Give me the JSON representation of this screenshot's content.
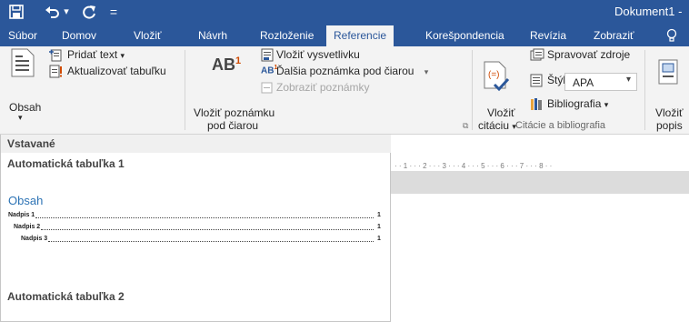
{
  "qat": {
    "save_icon": "save-icon",
    "undo_icon": "undo-icon",
    "undo_dropdown_glyph": "▾",
    "redo_icon": "redo-icon",
    "customize_glyph": "=",
    "document_title": "Dokument1 -"
  },
  "tabs": [
    {
      "label": "Súbor"
    },
    {
      "label": "Domov"
    },
    {
      "label": "Vložiť"
    },
    {
      "label": "Návrh"
    },
    {
      "label": "Rozloženie"
    },
    {
      "label": "Referencie",
      "active": true
    },
    {
      "label": "Korešpondencia"
    },
    {
      "label": "Revízia"
    },
    {
      "label": "Zobraziť"
    }
  ],
  "ribbon": {
    "toc": {
      "button_label": "Obsah",
      "add_text": "Pridať text",
      "update_table": "Aktualizovať tabuľku"
    },
    "footnotes": {
      "insert_footnote_line1": "Vložiť poznámku",
      "insert_footnote_line2": "pod čiarou",
      "insert_endnote": "Vložiť vysvetlivku",
      "next_footnote": "Ďalšia poznámka pod čiarou",
      "show_notes": "Zobraziť poznámky"
    },
    "citations": {
      "insert_citation_line1": "Vložiť",
      "insert_citation_line2": "citáciu",
      "manage_sources": "Spravovať zdroje",
      "style_label": "Štýl:",
      "style_value": "APA",
      "bibliography": "Bibliografia",
      "group_label": "Citácie a bibliografia"
    },
    "captions": {
      "insert_caption_line1": "Vložiť",
      "insert_caption_line2": "popis"
    }
  },
  "toc_gallery": {
    "section_header": "Vstavané",
    "item1_title": "Automatická tabuľka 1",
    "preview_heading": "Obsah",
    "preview_lines": [
      {
        "text": "Nadpis 1",
        "page": "1"
      },
      {
        "text": "Nadpis 2",
        "page": "1"
      },
      {
        "text": "Nadpis 3",
        "page": "1"
      }
    ],
    "item2_title": "Automatická tabuľka 2"
  },
  "ruler": {
    "text": "· · 1 · · · 2 · · · 3 · · · 4 · · · 5 · · · 6 · · · 7 · · · 8 · ·"
  },
  "colors": {
    "brand": "#2b579a",
    "toc_heading": "#2e74b5",
    "ribbon_bg": "#f3f3f3"
  }
}
